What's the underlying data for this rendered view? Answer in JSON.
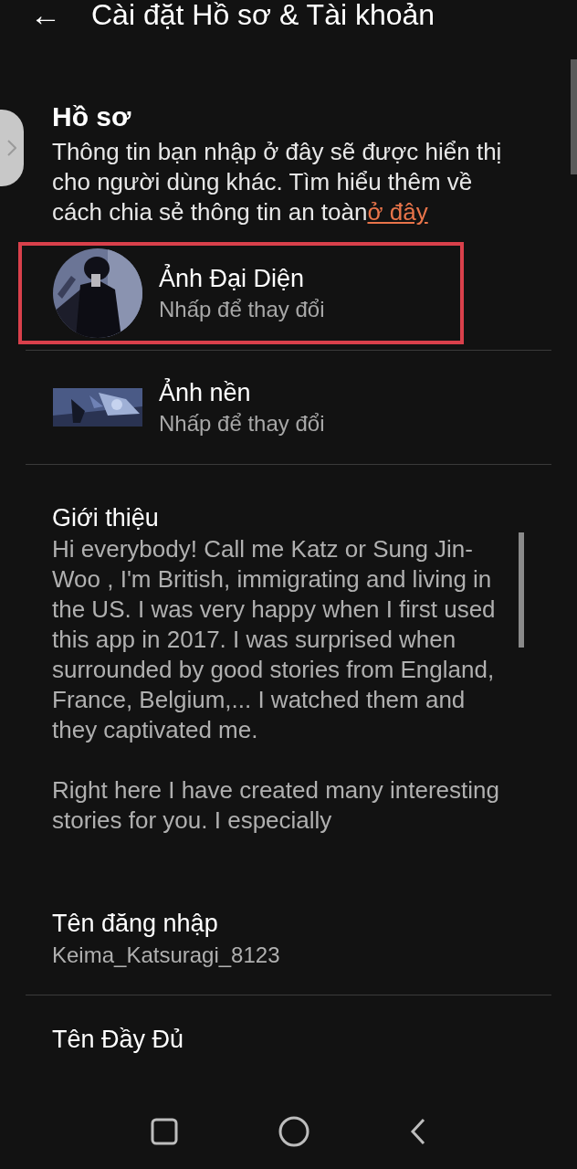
{
  "header": {
    "back": "←",
    "title": "Cài đặt Hồ sơ & Tài khoản"
  },
  "section": {
    "title": "Hồ sơ",
    "description": "Thông tin bạn nhập ở đây sẽ được hiển thị cho người dùng khác. Tìm hiểu thêm về cách chia sẻ thông tin an toàn",
    "link": "ở đây"
  },
  "images": [
    {
      "kind": "avatar",
      "title": "Ảnh Đại Diện",
      "subtitle": "Nhấp để thay đổi",
      "highlighted": true
    },
    {
      "kind": "banner",
      "title": "Ảnh nền",
      "subtitle": "Nhấp để thay đổi",
      "highlighted": false
    }
  ],
  "bio": {
    "label": "Giới thiệu",
    "paragraphs": [
      "Hi everybody! Call me Katz or Sung Jin-Woo , I'm British, immigrating and living in the US. I was very happy when I first used this app in 2017. I was surprised when surrounded by good stories from England, France, Belgium,... I watched them and they captivated me.",
      "Right here I have created many interesting stories for you. I especially"
    ]
  },
  "fields": [
    {
      "label": "Tên đăng nhập",
      "value": "Keima_Katsuragi_8123"
    },
    {
      "label": "Tên Đầy Đủ"
    }
  ]
}
